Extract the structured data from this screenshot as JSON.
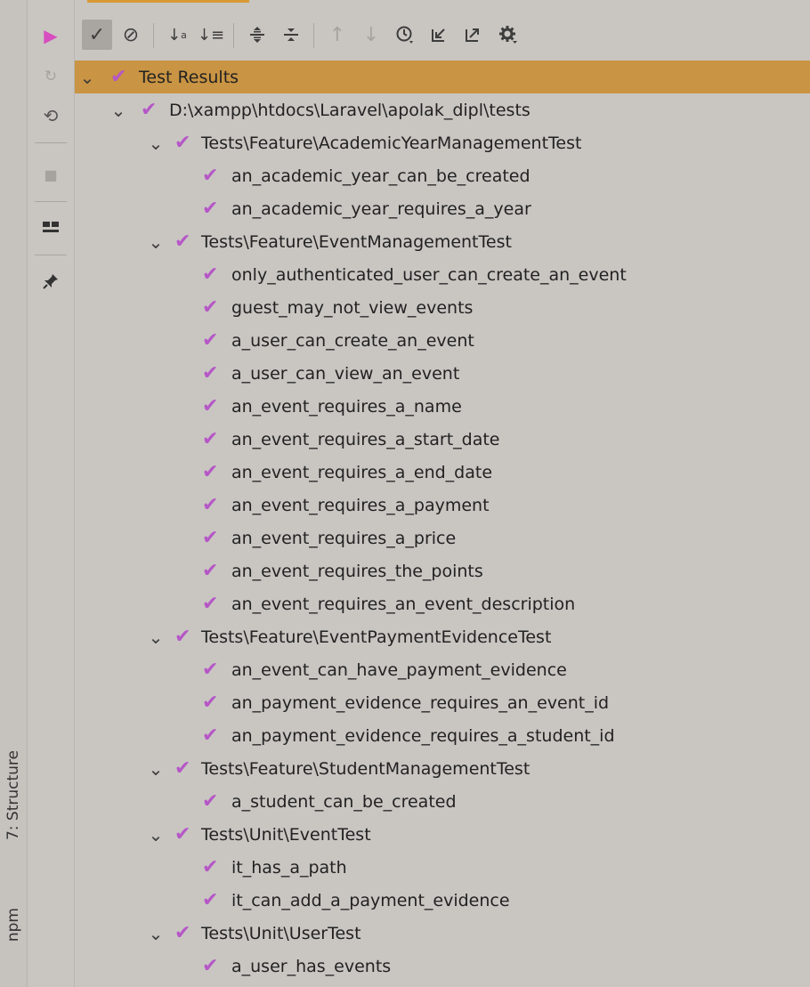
{
  "colors": {
    "selected_row": "#c99443",
    "pass_check": "#b557c6",
    "run_button": "#d84dc0",
    "background": "#c9c6c2"
  },
  "left_tool_strip": {
    "tabs": [
      {
        "label": "7: Structure",
        "icon": "structure-icon"
      },
      {
        "label": "npm",
        "icon": "npm-icon"
      }
    ]
  },
  "run_toolbar": {
    "buttons": [
      {
        "icon": "run-icon",
        "glyph": "▶"
      },
      {
        "icon": "rerun-failed-icon",
        "glyph": "↻"
      },
      {
        "icon": "toggle-auto-test-icon",
        "glyph": "⟲"
      },
      {
        "icon": "stop-icon",
        "glyph": "■"
      },
      {
        "icon": "layout-icon",
        "glyph": "▬"
      },
      {
        "icon": "pin-icon",
        "glyph": "📌"
      }
    ]
  },
  "top_toolbar": {
    "buttons": [
      {
        "icon": "show-passed-icon",
        "glyph": "✓",
        "pressed": true
      },
      {
        "icon": "show-ignored-icon",
        "glyph": "⊘",
        "pressed": false
      },
      {
        "icon": "sort-alphabetically-icon",
        "glyph": "↓ᵃ",
        "pressed": false
      },
      {
        "icon": "sort-by-duration-icon",
        "glyph": "↓≡",
        "pressed": false
      },
      {
        "icon": "expand-all-icon",
        "glyph": "⇕",
        "pressed": false
      },
      {
        "icon": "collapse-all-icon",
        "glyph": "⇳",
        "pressed": false
      },
      {
        "icon": "previous-failed-icon",
        "glyph": "↑",
        "pressed": false,
        "disabled": true
      },
      {
        "icon": "next-failed-icon",
        "glyph": "↓",
        "pressed": false,
        "disabled": true
      },
      {
        "icon": "test-history-icon",
        "glyph": "⌚",
        "pressed": false
      },
      {
        "icon": "import-tests-icon",
        "glyph": "⇙",
        "pressed": false
      },
      {
        "icon": "export-tests-icon",
        "glyph": "⇗",
        "pressed": false
      },
      {
        "icon": "settings-icon",
        "glyph": "⚙",
        "pressed": false
      }
    ]
  },
  "tree": {
    "rows": [
      {
        "level": 0,
        "label": "Test Results",
        "expandable": true,
        "selected": true
      },
      {
        "level": 1,
        "label": "D:\\xampp\\htdocs\\Laravel\\apolak_dipl\\tests",
        "expandable": true
      },
      {
        "level": 2,
        "label": "Tests\\Feature\\AcademicYearManagementTest",
        "expandable": true
      },
      {
        "level": 3,
        "label": "an_academic_year_can_be_created"
      },
      {
        "level": 3,
        "label": "an_academic_year_requires_a_year"
      },
      {
        "level": 2,
        "label": "Tests\\Feature\\EventManagementTest",
        "expandable": true
      },
      {
        "level": 3,
        "label": "only_authenticated_user_can_create_an_event"
      },
      {
        "level": 3,
        "label": "guest_may_not_view_events"
      },
      {
        "level": 3,
        "label": "a_user_can_create_an_event"
      },
      {
        "level": 3,
        "label": "a_user_can_view_an_event"
      },
      {
        "level": 3,
        "label": "an_event_requires_a_name"
      },
      {
        "level": 3,
        "label": "an_event_requires_a_start_date"
      },
      {
        "level": 3,
        "label": "an_event_requires_a_end_date"
      },
      {
        "level": 3,
        "label": "an_event_requires_a_payment"
      },
      {
        "level": 3,
        "label": "an_event_requires_a_price"
      },
      {
        "level": 3,
        "label": "an_event_requires_the_points"
      },
      {
        "level": 3,
        "label": "an_event_requires_an_event_description"
      },
      {
        "level": 2,
        "label": "Tests\\Feature\\EventPaymentEvidenceTest",
        "expandable": true
      },
      {
        "level": 3,
        "label": "an_event_can_have_payment_evidence"
      },
      {
        "level": 3,
        "label": "an_payment_evidence_requires_an_event_id"
      },
      {
        "level": 3,
        "label": "an_payment_evidence_requires_a_student_id"
      },
      {
        "level": 2,
        "label": "Tests\\Feature\\StudentManagementTest",
        "expandable": true
      },
      {
        "level": 3,
        "label": "a_student_can_be_created"
      },
      {
        "level": 2,
        "label": "Tests\\Unit\\EventTest",
        "expandable": true
      },
      {
        "level": 3,
        "label": "it_has_a_path"
      },
      {
        "level": 3,
        "label": "it_can_add_a_payment_evidence"
      },
      {
        "level": 2,
        "label": "Tests\\Unit\\UserTest",
        "expandable": true
      },
      {
        "level": 3,
        "label": "a_user_has_events"
      }
    ]
  }
}
